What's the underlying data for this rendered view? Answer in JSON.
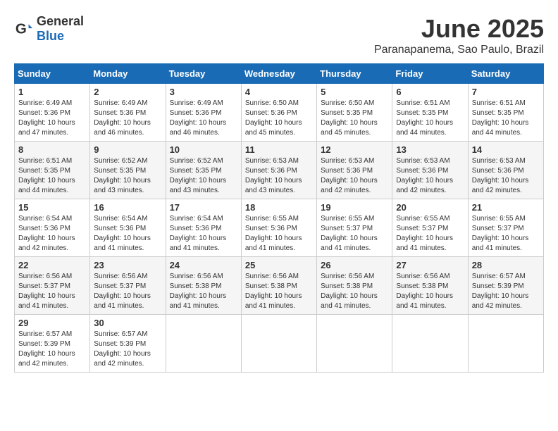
{
  "header": {
    "logo_general": "General",
    "logo_blue": "Blue",
    "title": "June 2025",
    "subtitle": "Paranapanema, Sao Paulo, Brazil"
  },
  "calendar": {
    "days_of_week": [
      "Sunday",
      "Monday",
      "Tuesday",
      "Wednesday",
      "Thursday",
      "Friday",
      "Saturday"
    ],
    "weeks": [
      [
        null,
        {
          "day": "2",
          "sunrise": "6:49 AM",
          "sunset": "5:36 PM",
          "daylight": "10 hours and 46 minutes."
        },
        {
          "day": "3",
          "sunrise": "6:49 AM",
          "sunset": "5:36 PM",
          "daylight": "10 hours and 46 minutes."
        },
        {
          "day": "4",
          "sunrise": "6:50 AM",
          "sunset": "5:36 PM",
          "daylight": "10 hours and 45 minutes."
        },
        {
          "day": "5",
          "sunrise": "6:50 AM",
          "sunset": "5:35 PM",
          "daylight": "10 hours and 45 minutes."
        },
        {
          "day": "6",
          "sunrise": "6:51 AM",
          "sunset": "5:35 PM",
          "daylight": "10 hours and 44 minutes."
        },
        {
          "day": "7",
          "sunrise": "6:51 AM",
          "sunset": "5:35 PM",
          "daylight": "10 hours and 44 minutes."
        }
      ],
      [
        {
          "day": "1",
          "sunrise": "6:49 AM",
          "sunset": "5:36 PM",
          "daylight": "10 hours and 47 minutes."
        },
        {
          "day": "8",
          "sunrise": "6:51 AM",
          "sunset": "5:35 PM",
          "daylight": "10 hours and 44 minutes."
        },
        {
          "day": "9",
          "sunrise": "6:52 AM",
          "sunset": "5:35 PM",
          "daylight": "10 hours and 43 minutes."
        },
        {
          "day": "10",
          "sunrise": "6:52 AM",
          "sunset": "5:35 PM",
          "daylight": "10 hours and 43 minutes."
        },
        {
          "day": "11",
          "sunrise": "6:53 AM",
          "sunset": "5:36 PM",
          "daylight": "10 hours and 43 minutes."
        },
        {
          "day": "12",
          "sunrise": "6:53 AM",
          "sunset": "5:36 PM",
          "daylight": "10 hours and 42 minutes."
        },
        {
          "day": "13",
          "sunrise": "6:53 AM",
          "sunset": "5:36 PM",
          "daylight": "10 hours and 42 minutes."
        },
        {
          "day": "14",
          "sunrise": "6:53 AM",
          "sunset": "5:36 PM",
          "daylight": "10 hours and 42 minutes."
        }
      ],
      [
        {
          "day": "15",
          "sunrise": "6:54 AM",
          "sunset": "5:36 PM",
          "daylight": "10 hours and 42 minutes."
        },
        {
          "day": "16",
          "sunrise": "6:54 AM",
          "sunset": "5:36 PM",
          "daylight": "10 hours and 41 minutes."
        },
        {
          "day": "17",
          "sunrise": "6:54 AM",
          "sunset": "5:36 PM",
          "daylight": "10 hours and 41 minutes."
        },
        {
          "day": "18",
          "sunrise": "6:55 AM",
          "sunset": "5:36 PM",
          "daylight": "10 hours and 41 minutes."
        },
        {
          "day": "19",
          "sunrise": "6:55 AM",
          "sunset": "5:37 PM",
          "daylight": "10 hours and 41 minutes."
        },
        {
          "day": "20",
          "sunrise": "6:55 AM",
          "sunset": "5:37 PM",
          "daylight": "10 hours and 41 minutes."
        },
        {
          "day": "21",
          "sunrise": "6:55 AM",
          "sunset": "5:37 PM",
          "daylight": "10 hours and 41 minutes."
        }
      ],
      [
        {
          "day": "22",
          "sunrise": "6:56 AM",
          "sunset": "5:37 PM",
          "daylight": "10 hours and 41 minutes."
        },
        {
          "day": "23",
          "sunrise": "6:56 AM",
          "sunset": "5:37 PM",
          "daylight": "10 hours and 41 minutes."
        },
        {
          "day": "24",
          "sunrise": "6:56 AM",
          "sunset": "5:38 PM",
          "daylight": "10 hours and 41 minutes."
        },
        {
          "day": "25",
          "sunrise": "6:56 AM",
          "sunset": "5:38 PM",
          "daylight": "10 hours and 41 minutes."
        },
        {
          "day": "26",
          "sunrise": "6:56 AM",
          "sunset": "5:38 PM",
          "daylight": "10 hours and 41 minutes."
        },
        {
          "day": "27",
          "sunrise": "6:56 AM",
          "sunset": "5:38 PM",
          "daylight": "10 hours and 41 minutes."
        },
        {
          "day": "28",
          "sunrise": "6:57 AM",
          "sunset": "5:39 PM",
          "daylight": "10 hours and 42 minutes."
        }
      ],
      [
        {
          "day": "29",
          "sunrise": "6:57 AM",
          "sunset": "5:39 PM",
          "daylight": "10 hours and 42 minutes."
        },
        {
          "day": "30",
          "sunrise": "6:57 AM",
          "sunset": "5:39 PM",
          "daylight": "10 hours and 42 minutes."
        },
        null,
        null,
        null,
        null,
        null
      ]
    ]
  }
}
